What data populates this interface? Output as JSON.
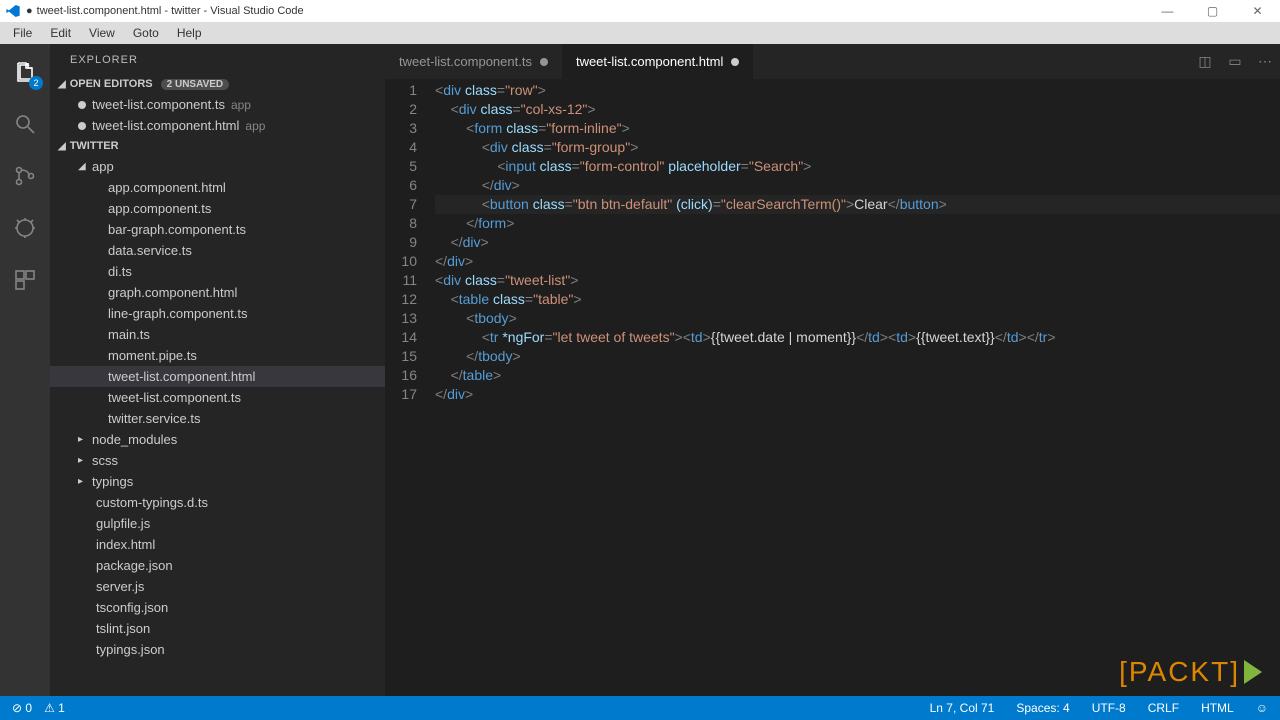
{
  "window": {
    "title_prefix": "●",
    "title": "tweet-list.component.html - twitter - Visual Studio Code"
  },
  "menubar": [
    "File",
    "Edit",
    "View",
    "Goto",
    "Help"
  ],
  "activitybar": {
    "badge": "2"
  },
  "sidebar": {
    "header": "EXPLORER",
    "open_editors": {
      "label": "OPEN EDITORS",
      "badge": "2 UNSAVED",
      "items": [
        {
          "label": "tweet-list.component.ts",
          "suffix": "app"
        },
        {
          "label": "tweet-list.component.html",
          "suffix": "app"
        }
      ]
    },
    "project": {
      "label": "TWITTER",
      "folders": [
        {
          "name": "app",
          "expanded": true,
          "children": [
            "app.component.html",
            "app.component.ts",
            "bar-graph.component.ts",
            "data.service.ts",
            "di.ts",
            "graph.component.html",
            "line-graph.component.ts",
            "main.ts",
            "moment.pipe.ts",
            "tweet-list.component.html",
            "tweet-list.component.ts",
            "twitter.service.ts"
          ],
          "selected": "tweet-list.component.html"
        },
        {
          "name": "node_modules",
          "expanded": false
        },
        {
          "name": "scss",
          "expanded": false
        },
        {
          "name": "typings",
          "expanded": false
        }
      ],
      "root_files": [
        "custom-typings.d.ts",
        "gulpfile.js",
        "index.html",
        "package.json",
        "server.js",
        "tsconfig.json",
        "tslint.json",
        "typings.json"
      ]
    }
  },
  "tabs": [
    {
      "label": "tweet-list.component.ts",
      "active": false,
      "modified": true
    },
    {
      "label": "tweet-list.component.html",
      "active": true,
      "modified": true
    }
  ],
  "code": {
    "highlighted_line": 7,
    "lines": [
      {
        "n": 1,
        "indent": 0,
        "parts": [
          [
            "br",
            "<"
          ],
          [
            "tag",
            "div"
          ],
          [
            "txt",
            " "
          ],
          [
            "attr",
            "class"
          ],
          [
            "br",
            "="
          ],
          [
            "str",
            "\"row\""
          ],
          [
            "br",
            ">"
          ]
        ]
      },
      {
        "n": 2,
        "indent": 1,
        "parts": [
          [
            "br",
            "<"
          ],
          [
            "tag",
            "div"
          ],
          [
            "txt",
            " "
          ],
          [
            "attr",
            "class"
          ],
          [
            "br",
            "="
          ],
          [
            "str",
            "\"col-xs-12\""
          ],
          [
            "br",
            ">"
          ]
        ]
      },
      {
        "n": 3,
        "indent": 2,
        "parts": [
          [
            "br",
            "<"
          ],
          [
            "tag",
            "form"
          ],
          [
            "txt",
            " "
          ],
          [
            "attr",
            "class"
          ],
          [
            "br",
            "="
          ],
          [
            "str",
            "\"form-inline\""
          ],
          [
            "br",
            ">"
          ]
        ]
      },
      {
        "n": 4,
        "indent": 3,
        "parts": [
          [
            "br",
            "<"
          ],
          [
            "tag",
            "div"
          ],
          [
            "txt",
            " "
          ],
          [
            "attr",
            "class"
          ],
          [
            "br",
            "="
          ],
          [
            "str",
            "\"form-group\""
          ],
          [
            "br",
            ">"
          ]
        ]
      },
      {
        "n": 5,
        "indent": 4,
        "parts": [
          [
            "br",
            "<"
          ],
          [
            "tag",
            "input"
          ],
          [
            "txt",
            " "
          ],
          [
            "attr",
            "class"
          ],
          [
            "br",
            "="
          ],
          [
            "str",
            "\"form-control\""
          ],
          [
            "txt",
            " "
          ],
          [
            "attr",
            "placeholder"
          ],
          [
            "br",
            "="
          ],
          [
            "str",
            "\"Search\""
          ],
          [
            "br",
            ">"
          ]
        ]
      },
      {
        "n": 6,
        "indent": 3,
        "parts": [
          [
            "br",
            "</"
          ],
          [
            "tag",
            "div"
          ],
          [
            "br",
            ">"
          ]
        ]
      },
      {
        "n": 7,
        "indent": 3,
        "parts": [
          [
            "br",
            "<"
          ],
          [
            "tag",
            "button"
          ],
          [
            "txt",
            " "
          ],
          [
            "attr",
            "class"
          ],
          [
            "br",
            "="
          ],
          [
            "str",
            "\"btn btn-default\""
          ],
          [
            "txt",
            " "
          ],
          [
            "attr",
            "(click)"
          ],
          [
            "br",
            "="
          ],
          [
            "str",
            "\"clearSearchTerm()\""
          ],
          [
            "br",
            ">"
          ],
          [
            "txt",
            "Clear"
          ],
          [
            "br",
            "</"
          ],
          [
            "tag",
            "button"
          ],
          [
            "br",
            ">"
          ]
        ]
      },
      {
        "n": 8,
        "indent": 2,
        "parts": [
          [
            "br",
            "</"
          ],
          [
            "tag",
            "form"
          ],
          [
            "br",
            ">"
          ]
        ]
      },
      {
        "n": 9,
        "indent": 1,
        "parts": [
          [
            "br",
            "</"
          ],
          [
            "tag",
            "div"
          ],
          [
            "br",
            ">"
          ]
        ]
      },
      {
        "n": 10,
        "indent": 0,
        "parts": [
          [
            "br",
            "</"
          ],
          [
            "tag",
            "div"
          ],
          [
            "br",
            ">"
          ]
        ]
      },
      {
        "n": 11,
        "indent": 0,
        "parts": [
          [
            "br",
            "<"
          ],
          [
            "tag",
            "div"
          ],
          [
            "txt",
            " "
          ],
          [
            "attr",
            "class"
          ],
          [
            "br",
            "="
          ],
          [
            "str",
            "\"tweet-list\""
          ],
          [
            "br",
            ">"
          ]
        ]
      },
      {
        "n": 12,
        "indent": 1,
        "parts": [
          [
            "br",
            "<"
          ],
          [
            "tag",
            "table"
          ],
          [
            "txt",
            " "
          ],
          [
            "attr",
            "class"
          ],
          [
            "br",
            "="
          ],
          [
            "str",
            "\"table\""
          ],
          [
            "br",
            ">"
          ]
        ]
      },
      {
        "n": 13,
        "indent": 2,
        "parts": [
          [
            "br",
            "<"
          ],
          [
            "tag",
            "tbody"
          ],
          [
            "br",
            ">"
          ]
        ]
      },
      {
        "n": 14,
        "indent": 3,
        "parts": [
          [
            "br",
            "<"
          ],
          [
            "tag",
            "tr"
          ],
          [
            "txt",
            " "
          ],
          [
            "attr",
            "*ngFor"
          ],
          [
            "br",
            "="
          ],
          [
            "str",
            "\"let tweet of tweets\""
          ],
          [
            "br",
            ">"
          ],
          [
            "br",
            "<"
          ],
          [
            "tag",
            "td"
          ],
          [
            "br",
            ">"
          ],
          [
            "txt",
            "{{tweet.date | moment}}"
          ],
          [
            "br",
            "</"
          ],
          [
            "tag",
            "td"
          ],
          [
            "br",
            ">"
          ],
          [
            "br",
            "<"
          ],
          [
            "tag",
            "td"
          ],
          [
            "br",
            ">"
          ],
          [
            "txt",
            "{{tweet.text}}"
          ],
          [
            "br",
            "</"
          ],
          [
            "tag",
            "td"
          ],
          [
            "br",
            ">"
          ],
          [
            "br",
            "</"
          ],
          [
            "tag",
            "tr"
          ],
          [
            "br",
            ">"
          ]
        ]
      },
      {
        "n": 15,
        "indent": 2,
        "parts": [
          [
            "br",
            "</"
          ],
          [
            "tag",
            "tbody"
          ],
          [
            "br",
            ">"
          ]
        ]
      },
      {
        "n": 16,
        "indent": 1,
        "parts": [
          [
            "br",
            "</"
          ],
          [
            "tag",
            "table"
          ],
          [
            "br",
            ">"
          ]
        ]
      },
      {
        "n": 17,
        "indent": 0,
        "parts": [
          [
            "br",
            "</"
          ],
          [
            "tag",
            "div"
          ],
          [
            "br",
            ">"
          ]
        ]
      }
    ]
  },
  "statusbar": {
    "errors": "0",
    "warnings": "1",
    "ln_col": "Ln 7, Col 71",
    "spaces": "Spaces: 4",
    "encoding": "UTF-8",
    "eol": "CRLF",
    "lang": "HTML"
  },
  "watermark": "[PACKT]"
}
